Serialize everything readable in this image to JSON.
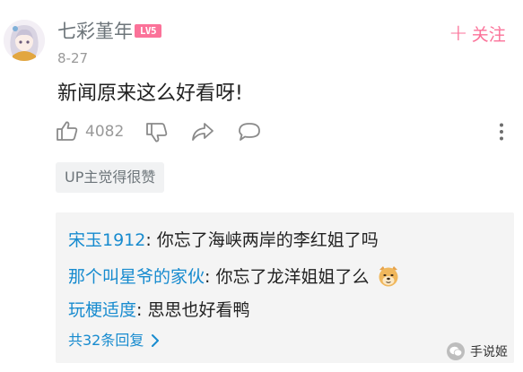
{
  "comment": {
    "username": "七彩堇年",
    "level_badge": "LV5",
    "follow_label": "关注",
    "date": "8-27",
    "content": "新闻原来这么好看呀!",
    "like_count": "4082",
    "up_tag": "UP主觉得很赞"
  },
  "replies": [
    {
      "name": "宋玉1912",
      "text": ": 你忘了海峡两岸的李红姐了吗"
    },
    {
      "name": "那个叫星爷的家伙",
      "text": ": 你忘了龙洋姐姐了么"
    },
    {
      "name": "玩梗适度",
      "text": ": 思思也好看鸭"
    }
  ],
  "more_replies_label": "共32条回复",
  "watermark": "手说姬",
  "colors": {
    "accent_pink": "#fb7299",
    "link_blue": "#178bcf",
    "muted": "#999999"
  },
  "icons": [
    "plus-icon",
    "thumb-up-icon",
    "thumb-down-icon",
    "share-icon",
    "comment-icon",
    "more-vertical-icon",
    "chevron-right-icon",
    "doge-emoji-icon",
    "wechat-icon"
  ]
}
